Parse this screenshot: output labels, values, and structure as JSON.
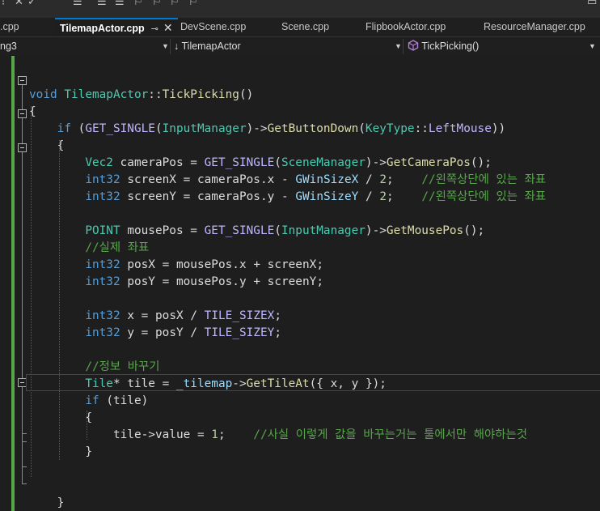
{
  "tabs": [
    {
      "label": ".cpp",
      "active": false
    },
    {
      "label": "TilemapActor.cpp",
      "active": true,
      "pin_glyph": "⊸",
      "close_glyph": "✕"
    },
    {
      "label": "DevScene.cpp",
      "active": false
    },
    {
      "label": "Scene.cpp",
      "active": false
    },
    {
      "label": "FlipbookActor.cpp",
      "active": false
    },
    {
      "label": "ResourceManager.cpp",
      "active": false
    }
  ],
  "navbar": {
    "project": "ng3",
    "scope": "TilemapActor",
    "scope_icon": "↓",
    "member": "TickPicking()"
  },
  "code_lines": [
    "",
    "void TilemapActor::TickPicking()",
    "{",
    "    if (GET_SINGLE(InputManager)->GetButtonDown(KeyType::LeftMouse))",
    "    {",
    "        Vec2 cameraPos = GET_SINGLE(SceneManager)->GetCameraPos();",
    "        int32 screenX = cameraPos.x - GWinSizeX / 2;    //왼쪽상단에 있는 좌표",
    "        int32 screenY = cameraPos.y - GWinSizeY / 2;    //왼쪽상단에 있는 좌표",
    "",
    "        POINT mousePos = GET_SINGLE(InputManager)->GetMousePos();",
    "        //실제 좌표",
    "        int32 posX = mousePos.x + screenX;",
    "        int32 posY = mousePos.y + screenY;",
    "",
    "        int32 x = posX / TILE_SIZEX;",
    "        int32 y = posY / TILE_SIZEY;",
    "",
    "        //정보 바꾸기",
    "        Tile* tile = _tilemap->GetTileAt({ x, y });",
    "        if (tile)",
    "        {",
    "            tile->value = 1;    //사실 이렇게 값을 바꾸는거는 툴에서만 해야하는것",
    "        }",
    "",
    "",
    "    }",
    "}"
  ],
  "colors": {
    "background": "#1e1e1e",
    "keyword": "#569cd6",
    "type": "#4ec9b0",
    "function": "#dcdcaa",
    "macro": "#beb7ff",
    "variable": "#9cdcfe",
    "number": "#b5cea8",
    "comment": "#57a64a",
    "text": "#dcdcdc",
    "active_tab_accent": "#0078d4"
  }
}
